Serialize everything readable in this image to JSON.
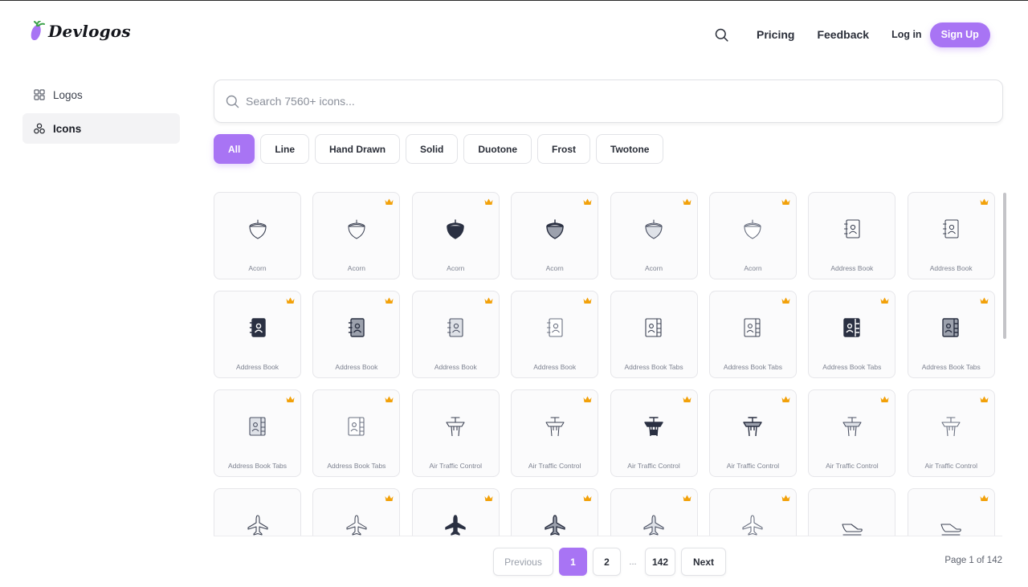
{
  "app": {
    "brand": "Devlogos",
    "accent_color": "#a874f4",
    "crown_color": "#f2a10a"
  },
  "header": {
    "nav": {
      "search_icon": "search-icon",
      "pricing": "Pricing",
      "feedback": "Feedback",
      "login": "Log in",
      "signup": "Sign Up"
    }
  },
  "sidebar": {
    "items": [
      {
        "label": "Logos",
        "icon": "grid-icon",
        "active": false
      },
      {
        "label": "Icons",
        "icon": "shapes-icon",
        "active": true
      }
    ]
  },
  "search": {
    "placeholder": "Search 7560+ icons...",
    "value": ""
  },
  "filters": {
    "chips": [
      {
        "label": "All",
        "active": true
      },
      {
        "label": "Line",
        "active": false
      },
      {
        "label": "Hand Drawn",
        "active": false
      },
      {
        "label": "Solid",
        "active": false
      },
      {
        "label": "Duotone",
        "active": false
      },
      {
        "label": "Frost",
        "active": false
      },
      {
        "label": "Twotone",
        "active": false
      }
    ]
  },
  "icons": [
    {
      "label": "Acorn",
      "glyph": "acorn",
      "variant": "line",
      "premium": false
    },
    {
      "label": "Acorn",
      "glyph": "acorn",
      "variant": "hand",
      "premium": true
    },
    {
      "label": "Acorn",
      "glyph": "acorn",
      "variant": "solid",
      "premium": true
    },
    {
      "label": "Acorn",
      "glyph": "acorn",
      "variant": "duotone",
      "premium": true
    },
    {
      "label": "Acorn",
      "glyph": "acorn",
      "variant": "frost",
      "premium": true
    },
    {
      "label": "Acorn",
      "glyph": "acorn",
      "variant": "twotone",
      "premium": true
    },
    {
      "label": "Address Book",
      "glyph": "book",
      "variant": "line",
      "premium": false
    },
    {
      "label": "Address Book",
      "glyph": "book",
      "variant": "hand",
      "premium": true
    },
    {
      "label": "Address Book",
      "glyph": "book",
      "variant": "solid",
      "premium": true
    },
    {
      "label": "Address Book",
      "glyph": "book",
      "variant": "duotone",
      "premium": true
    },
    {
      "label": "Address Book",
      "glyph": "book",
      "variant": "frost",
      "premium": true
    },
    {
      "label": "Address Book",
      "glyph": "book",
      "variant": "twotone",
      "premium": true
    },
    {
      "label": "Address Book Tabs",
      "glyph": "booktabs",
      "variant": "line",
      "premium": false
    },
    {
      "label": "Address Book Tabs",
      "glyph": "booktabs",
      "variant": "hand",
      "premium": true
    },
    {
      "label": "Address Book Tabs",
      "glyph": "booktabs",
      "variant": "solid",
      "premium": true
    },
    {
      "label": "Address Book Tabs",
      "glyph": "booktabs",
      "variant": "duotone",
      "premium": true
    },
    {
      "label": "Address Book Tabs",
      "glyph": "booktabs",
      "variant": "frost",
      "premium": true
    },
    {
      "label": "Address Book Tabs",
      "glyph": "booktabs",
      "variant": "twotone",
      "premium": true
    },
    {
      "label": "Air Traffic Control",
      "glyph": "tower",
      "variant": "line",
      "premium": false
    },
    {
      "label": "Air Traffic Control",
      "glyph": "tower",
      "variant": "hand",
      "premium": true
    },
    {
      "label": "Air Traffic Control",
      "glyph": "tower",
      "variant": "solid",
      "premium": true
    },
    {
      "label": "Air Traffic Control",
      "glyph": "tower",
      "variant": "duotone",
      "premium": true
    },
    {
      "label": "Air Traffic Control",
      "glyph": "tower",
      "variant": "frost",
      "premium": true
    },
    {
      "label": "Air Traffic Control",
      "glyph": "tower",
      "variant": "twotone",
      "premium": true
    },
    {
      "label": "",
      "glyph": "plane",
      "variant": "line",
      "premium": false
    },
    {
      "label": "",
      "glyph": "plane",
      "variant": "hand",
      "premium": true
    },
    {
      "label": "",
      "glyph": "plane",
      "variant": "solid",
      "premium": true
    },
    {
      "label": "",
      "glyph": "plane",
      "variant": "duotone",
      "premium": true
    },
    {
      "label": "",
      "glyph": "plane",
      "variant": "frost",
      "premium": true
    },
    {
      "label": "",
      "glyph": "plane",
      "variant": "twotone",
      "premium": true
    },
    {
      "label": "",
      "glyph": "landing",
      "variant": "line",
      "premium": false
    },
    {
      "label": "",
      "glyph": "landing",
      "variant": "hand",
      "premium": true
    }
  ],
  "pagination": {
    "previous": "Previous",
    "pages": [
      "1",
      "2"
    ],
    "ellipsis": "...",
    "last": "142",
    "next": "Next",
    "current_page": 1,
    "info": "Page 1 of 142"
  }
}
